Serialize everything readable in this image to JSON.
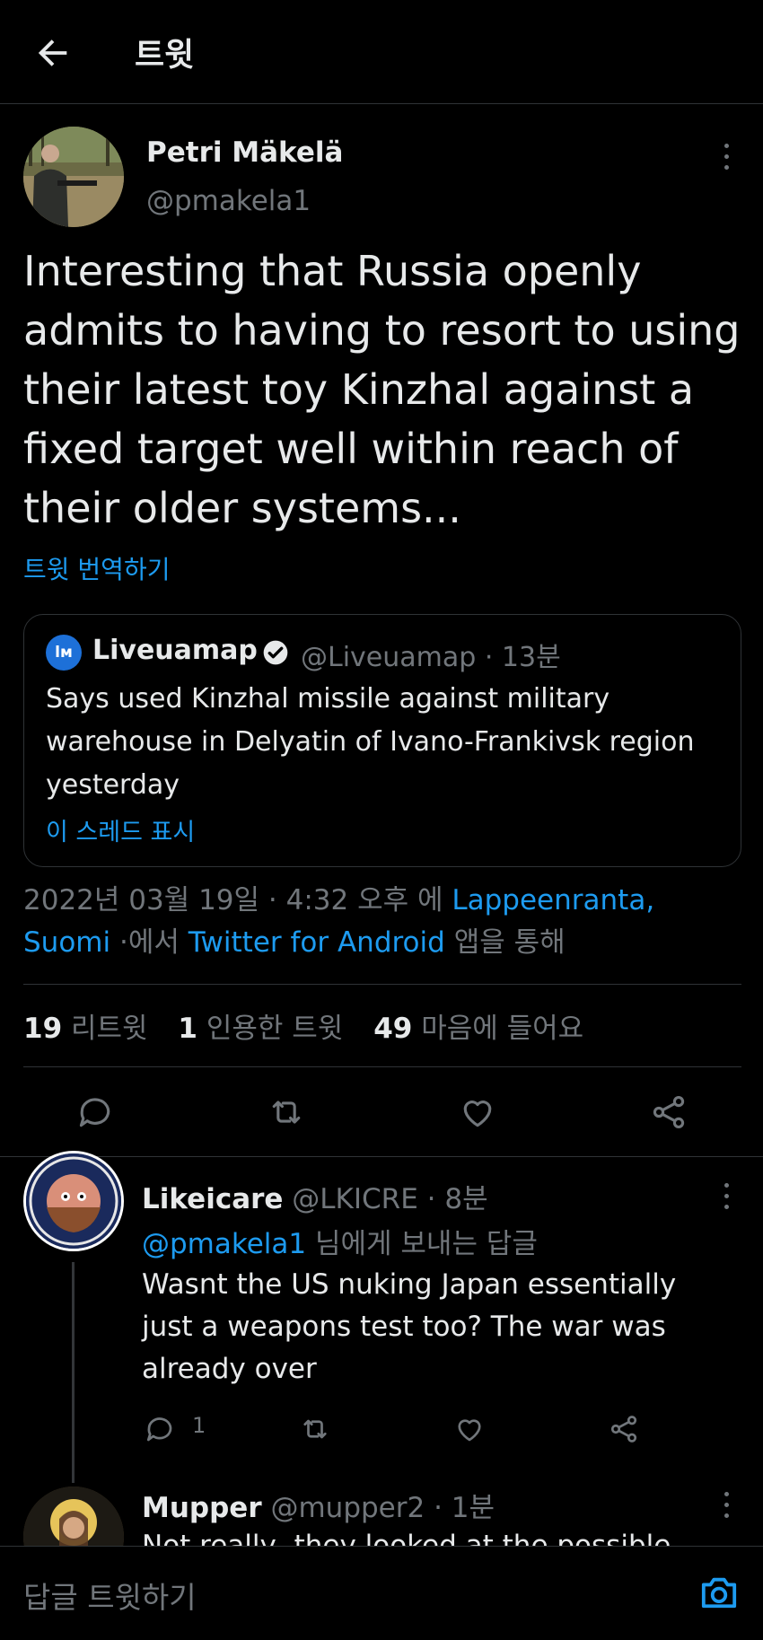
{
  "header": {
    "title": "트윗"
  },
  "tweet": {
    "author_name": "Petri Mäkelä",
    "author_handle": "@pmakela1",
    "text": "Interesting that Russia openly admits to having to resort to using their latest toy Kinzhal against a fixed target well within reach of their older systems...",
    "translate_label": "트윗 번역하기",
    "quote": {
      "avatar_letter": "lм",
      "name": "Liveuamap",
      "meta": "@Liveuamap · 13분",
      "text": "Says used Kinzhal missile against military warehouse in Delyatin of Ivano-Frankivsk region yesterday",
      "thread_label": "이 스레드 표시"
    },
    "timestamp": {
      "date": "2022년 03월 19일 · 4:32 오후 에",
      "location": "Lappeenranta, Suomi",
      "middle": "·에서",
      "client": "Twitter for Android",
      "end": "앱을 통해"
    },
    "stats": {
      "retweets": "19",
      "retweets_label": "리트윗",
      "quotes": "1",
      "quotes_label": "인용한 트윗",
      "likes": "49",
      "likes_label": "마음에 들어요"
    }
  },
  "replies": [
    {
      "name": "Likeicare",
      "meta": "@LKICRE · 8분",
      "reply_to_handle": "@pmakela1",
      "reply_to_suffix": "님에게 보내는 답글",
      "text": "Wasnt the US nuking Japan essentially just a weapons test too? The war was already over",
      "reply_count": "1"
    },
    {
      "name": "Mupper",
      "meta": "@mupper2 · 1분",
      "text_partial": "Not really, they looked at the possible"
    }
  ],
  "bottom_bar": {
    "reply_placeholder": "답글 트윗하기"
  },
  "colors": {
    "accent": "#1d9bf0",
    "background": "#000000",
    "secondary_text": "#71767b",
    "border": "#2f3336"
  }
}
